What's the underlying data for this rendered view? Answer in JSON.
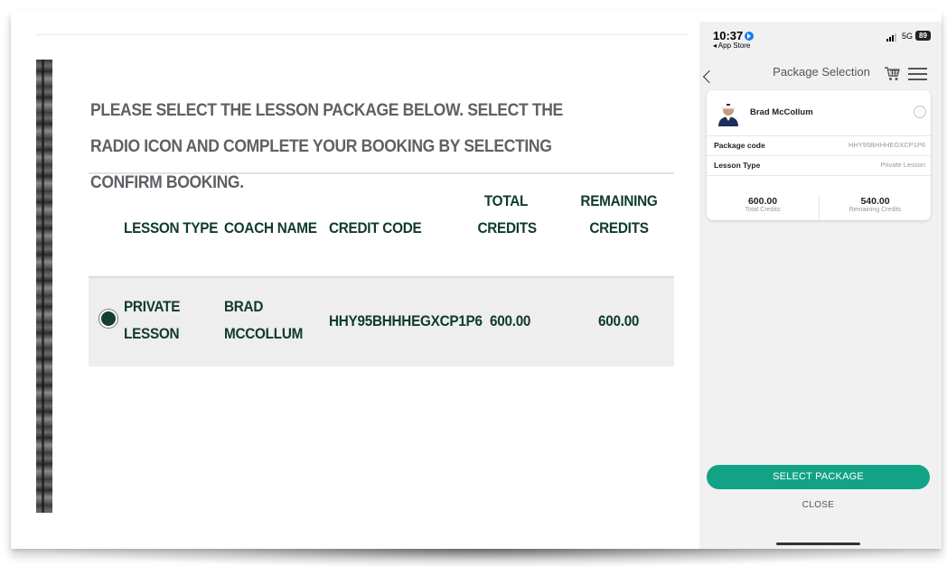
{
  "web": {
    "instructions": "PLEASE SELECT THE LESSON PACKAGE BELOW. SELECT THE RADIO ICON AND COMPLETE YOUR BOOKING BY SELECTING CONFIRM BOOKING.",
    "columns": {
      "lesson_type": "LESSON TYPE",
      "coach_name": "COACH NAME",
      "credit_code": "CREDIT CODE",
      "total_credits_1": "TOTAL",
      "total_credits_2": "CREDITS",
      "remaining_credits_1": "REMAINING",
      "remaining_credits_2": "CREDITS"
    },
    "row": {
      "lesson_type_1": "PRIVATE",
      "lesson_type_2": "LESSON",
      "coach_name_1": "BRAD",
      "coach_name_2": "MCCOLLUM",
      "credit_code": "HHY95BHHHEGXCP1P6",
      "total_credits": "600.00",
      "remaining_credits": "600.00"
    }
  },
  "phone": {
    "status": {
      "time": "10:37",
      "back_app": "◂ App Store",
      "network": "5G",
      "battery": "89"
    },
    "nav": {
      "title": "Package Selection"
    },
    "card": {
      "coach_name": "Brad McCollum",
      "package_code_label": "Package code",
      "package_code_value": "HHY95BHHHEGXCP1P6",
      "lesson_type_label": "Lesson Type",
      "lesson_type_value": "Private Lesson",
      "total_credits_value": "600.00",
      "total_credits_label": "Total Credits",
      "remaining_credits_value": "540.00",
      "remaining_credits_label": "Remaining Credits"
    },
    "select_button": "SELECT PACKAGE",
    "close_button": "CLOSE"
  },
  "colors": {
    "dark_green": "#0f3a2c",
    "accent_teal": "#12a386",
    "location_blue": "#1a7cf5"
  },
  "icons": [
    "back-chevron-icon",
    "cart-icon",
    "menu-icon",
    "location-arrow-icon",
    "signal-icon",
    "battery-icon"
  ]
}
